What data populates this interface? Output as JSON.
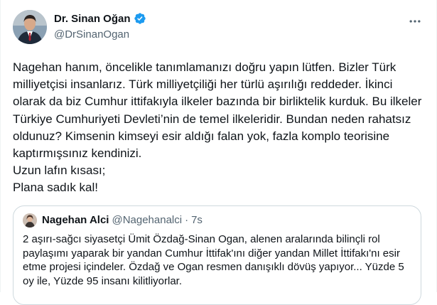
{
  "author": {
    "display_name": "Dr. Sinan Oğan",
    "handle": "@DrSinanOgan"
  },
  "tweet": {
    "lines": [
      "Nagehan hanım, öncelikle tanımlamanızı doğru yapın lütfen. Bizler Türk milliyetçisi insanlarız. Türk milliyetçiliği her türlü aşırılığı reddeder. İkinci olarak da biz Cumhur ittifakıyla ilkeler bazında bir birliktelik kurduk. Bu ilkeler Türkiye Cumhuriyeti Devleti’nin de temel ilkeleridir. Bundan neden rahatsız oldunuz?  Kimsenin kimseyi esir aldığı falan yok, fazla komplo teorisine kaptırmışsınız kendinizi.",
      "Uzun lafın kısası;",
      "Plana sadık kal!"
    ]
  },
  "quoted_tweet": {
    "display_name": "Nagehan Alci",
    "handle": "@Nagehanalci",
    "separator": "·",
    "time": "7s",
    "text": "2 aşırı-sağcı siyasetçi Ümit Özdağ-Sinan Ogan, alenen aralarında bilinçli rol paylaşımı yaparak bir yandan Cumhur İttifak'ını diğer yandan Millet İttifakı'nı esir etme projesi içindeler. Özdağ ve Ogan resmen danışıklı dövüş yapıyor... Yüzde 5 oy ile, Yüzde 95 insanı kilitliyorlar."
  },
  "icons": {
    "verified": "verified-badge-icon",
    "more": "more-options-icon"
  },
  "colors": {
    "verified_blue": "#1d9bf0",
    "secondary_text": "#536471",
    "border": "#cfd9de"
  }
}
